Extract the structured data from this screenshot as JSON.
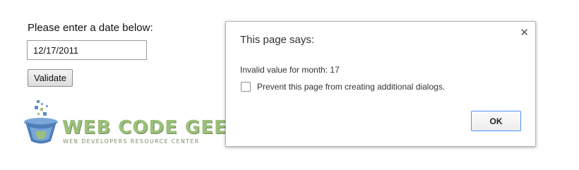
{
  "form": {
    "label": "Please enter a date below:",
    "date_value": "12/17/2011",
    "validate_label": "Validate"
  },
  "logo": {
    "name": "WEB CODE GEEKS",
    "tagline": "WEB DEVELOPERS RESOURCE CENTER",
    "icon": "glass-beaker-icon"
  },
  "dialog": {
    "title": "This page says:",
    "close_icon": "close-icon",
    "message": "Invalid value for month: 17",
    "suppress_label": "Prevent this page from creating additional dialogs.",
    "suppress_checked": false,
    "ok_label": "OK"
  },
  "colors": {
    "dialog_border": "#b9b9b9",
    "ok_focus_ring": "#4d90fe",
    "logo_green": "#9cc07a",
    "logo_blue": "#5b8fc9"
  }
}
